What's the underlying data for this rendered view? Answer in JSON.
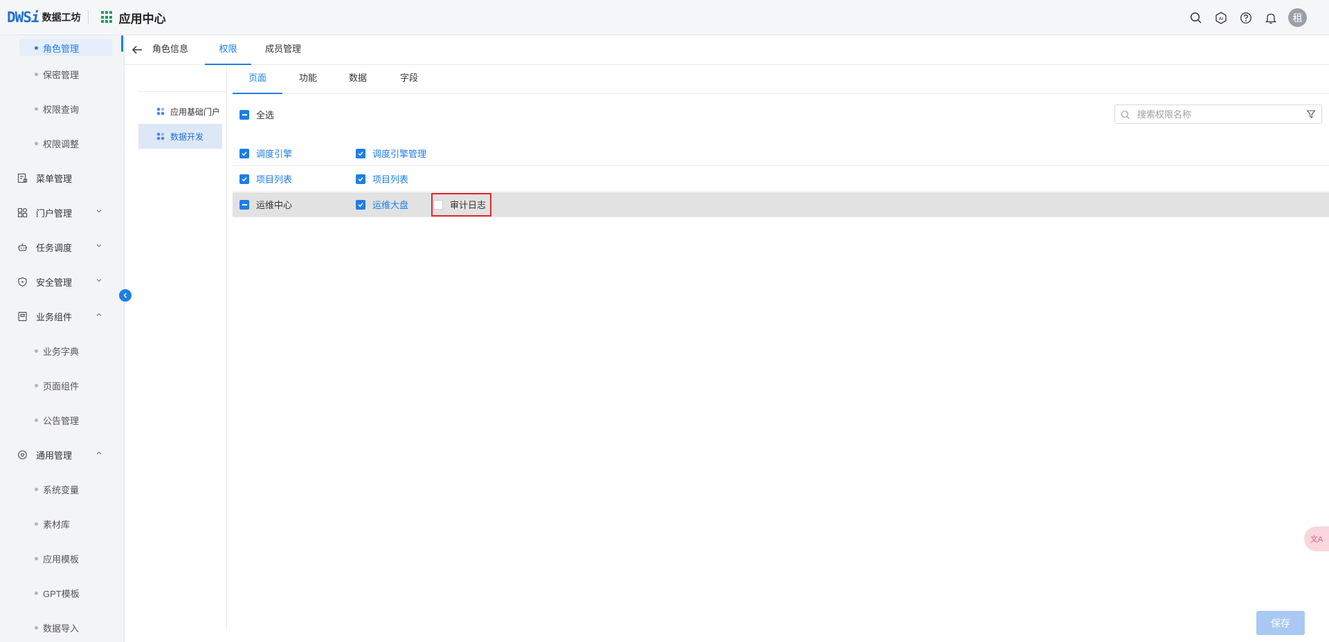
{
  "header": {
    "logo_mark": "DWS",
    "logo_mark_i": "i",
    "logo_text": "数据工坊",
    "app_title": "应用中心",
    "avatar_text": "租",
    "icons": [
      "search-icon",
      "ai-icon",
      "help-icon",
      "bell-icon"
    ]
  },
  "sidebar": {
    "items": [
      {
        "label": "角色管理",
        "type": "sub",
        "active": true
      },
      {
        "label": "保密管理",
        "type": "sub"
      },
      {
        "label": "权限查询",
        "type": "sub"
      },
      {
        "label": "权限调整",
        "type": "sub"
      },
      {
        "label": "菜单管理",
        "type": "main",
        "icon": "menu-manage-icon"
      },
      {
        "label": "门户管理",
        "type": "main",
        "icon": "portal-icon",
        "chevron": "down"
      },
      {
        "label": "任务调度",
        "type": "main",
        "icon": "robot-icon",
        "chevron": "down"
      },
      {
        "label": "安全管理",
        "type": "main",
        "icon": "shield-icon",
        "chevron": "down"
      },
      {
        "label": "业务组件",
        "type": "main",
        "icon": "component-icon",
        "chevron": "up"
      },
      {
        "label": "业务字典",
        "type": "sub"
      },
      {
        "label": "页面组件",
        "type": "sub"
      },
      {
        "label": "公告管理",
        "type": "sub"
      },
      {
        "label": "通用管理",
        "type": "main",
        "icon": "settings-icon",
        "chevron": "up"
      },
      {
        "label": "系统变量",
        "type": "sub"
      },
      {
        "label": "素材库",
        "type": "sub"
      },
      {
        "label": "应用模板",
        "type": "sub"
      },
      {
        "label": "GPT模板",
        "type": "sub"
      },
      {
        "label": "数据导入",
        "type": "sub"
      }
    ]
  },
  "role_tabs": [
    {
      "label": "角色信息"
    },
    {
      "label": "权限",
      "active": true
    },
    {
      "label": "成员管理"
    }
  ],
  "tree": [
    {
      "label": "应用基础门户"
    },
    {
      "label": "数据开发",
      "active": true
    }
  ],
  "sub_tabs": [
    {
      "label": "页面",
      "active": true
    },
    {
      "label": "功能"
    },
    {
      "label": "数据"
    },
    {
      "label": "字段"
    }
  ],
  "select_all": {
    "label": "全选",
    "state": "partial"
  },
  "search": {
    "placeholder": "搜索权限名称",
    "value": ""
  },
  "permission_rows": [
    {
      "group": {
        "label": "调度引擎",
        "state": "checked"
      },
      "items": [
        {
          "label": "调度引擎管理",
          "state": "checked"
        }
      ]
    },
    {
      "group": {
        "label": "项目列表",
        "state": "checked"
      },
      "items": [
        {
          "label": "项目列表",
          "state": "checked"
        }
      ]
    },
    {
      "group": {
        "label": "运维中心",
        "state": "partial"
      },
      "items": [
        {
          "label": "运维大盘",
          "state": "checked"
        },
        {
          "label": "审计日志",
          "state": "unchecked"
        }
      ]
    }
  ],
  "float_button": {
    "icon": "translate-icon",
    "label": "文A"
  },
  "save_label": "保存"
}
